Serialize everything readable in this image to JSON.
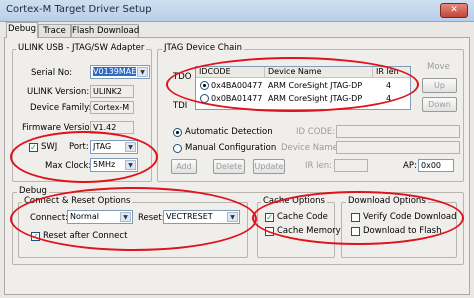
{
  "window": {
    "title": "Cortex-M Target Driver Setup",
    "close_glyph": "✕"
  },
  "tabs": [
    {
      "label": "Debug",
      "active": true
    },
    {
      "label": "Trace",
      "active": false
    },
    {
      "label": "Flash Download",
      "active": false
    }
  ],
  "adapter": {
    "group_title": "ULINK USB - JTAG/SW Adapter",
    "serial_label": "Serial No:",
    "serial_value": "V0139MAE",
    "ulink_version_label": "ULINK Version:",
    "ulink_version_value": "ULINK2",
    "device_family_label": "Device Family:",
    "device_family_value": "Cortex-M",
    "firmware_label": "Firmware Version:",
    "firmware_value": "V1.42",
    "swj_label": "SWJ",
    "swj_checked": true,
    "port_label": "Port:",
    "port_value": "JTAG",
    "max_clock_label": "Max Clock:",
    "max_clock_value": "5MHz"
  },
  "jtag_chain": {
    "group_title": "JTAG Device Chain",
    "tdo_label": "TDO",
    "tdi_label": "TDI",
    "columns": [
      "IDCODE",
      "Device Name",
      "IR len"
    ],
    "rows": [
      {
        "idcode": "0x4BA00477",
        "device_name": "ARM CoreSight JTAG-DP",
        "ir_len": "4",
        "selected": true
      },
      {
        "idcode": "0x0BA01477",
        "device_name": "ARM CoreSight JTAG-DP",
        "ir_len": "4",
        "selected": false
      }
    ],
    "move_label": "Move",
    "up_label": "Up",
    "down_label": "Down",
    "auto_detect_label": "Automatic Detection",
    "manual_config_label": "Manual Configuration",
    "id_code_label": "ID CODE:",
    "device_name_label": "Device Name:",
    "ir_len_label": "IR len:",
    "ap_label": "AP:",
    "ap_value": "0x00",
    "add_label": "Add",
    "delete_label": "Delete",
    "update_label": "Update"
  },
  "debug": {
    "group_title": "Debug",
    "connect_reset": {
      "group_title": "Connect & Reset Options",
      "connect_label": "Connect:",
      "connect_value": "Normal",
      "reset_label": "Reset:",
      "reset_value": "VECTRESET",
      "reset_after_connect_label": "Reset after Connect",
      "reset_after_connect_checked": true
    },
    "cache": {
      "group_title": "Cache Options",
      "cache_code_label": "Cache Code",
      "cache_code_checked": true,
      "cache_memory_label": "Cache Memory",
      "cache_memory_checked": false
    },
    "download": {
      "group_title": "Download Options",
      "verify_label": "Verify Code Download",
      "verify_checked": false,
      "download_flash_label": "Download to Flash",
      "download_flash_checked": false
    }
  },
  "colors": {
    "highlight_ring": "#e0121b",
    "selection": "#316ac5",
    "check": "#21a121"
  }
}
